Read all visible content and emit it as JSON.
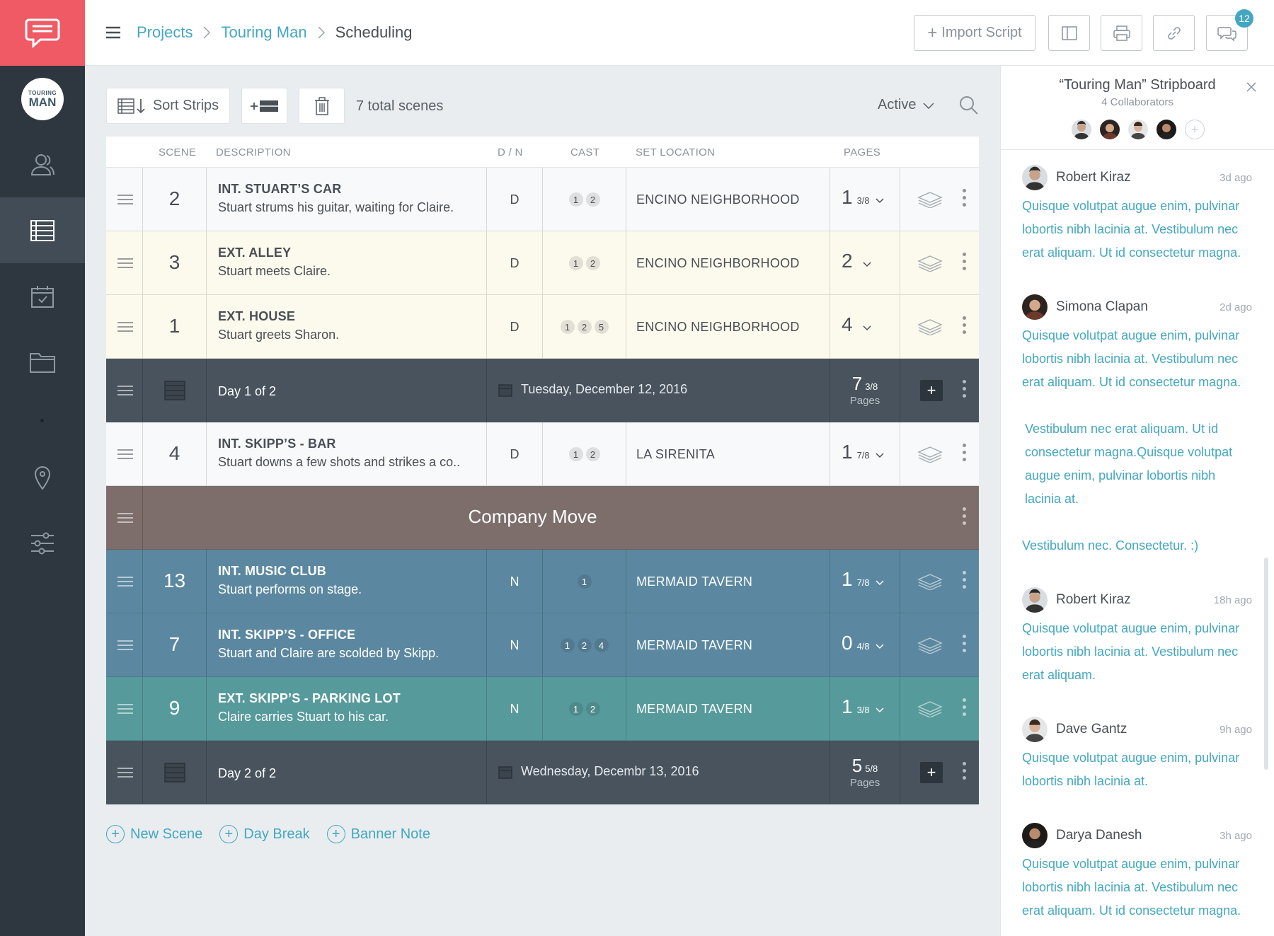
{
  "breadcrumb": {
    "projects": "Projects",
    "project": "Touring Man",
    "current": "Scheduling",
    "sep": ">"
  },
  "project_logo": {
    "line1": "TOURING",
    "line2": "MAN"
  },
  "topbar": {
    "import_label": "Import Script",
    "notifications_count": "12"
  },
  "toolbar": {
    "sort_label": "Sort Strips",
    "total_scenes": "7 total scenes",
    "filter_label": "Active"
  },
  "table": {
    "headers": {
      "scene": "SCENE",
      "description": "DESCRIPTION",
      "dn": "D / N",
      "cast": "CAST",
      "location": "SET LOCATION",
      "pages": "PAGES"
    },
    "rows": [
      {
        "scene": "2",
        "title": "INT. STUART’S CAR",
        "desc": "Stuart strums his guitar, waiting for Claire.",
        "dn": "D",
        "cast": [
          "1",
          "2"
        ],
        "location": "ENCINO NEIGHBORHOOD",
        "pages_whole": "1",
        "pages_frac": "3/8"
      },
      {
        "scene": "3",
        "title": "EXT. ALLEY",
        "desc": "Stuart meets Claire.",
        "dn": "D",
        "cast": [
          "1",
          "2"
        ],
        "location": "ENCINO NEIGHBORHOOD",
        "pages_whole": "2",
        "pages_frac": ""
      },
      {
        "scene": "1",
        "title": "EXT. HOUSE",
        "desc": "Stuart greets Sharon.",
        "dn": "D",
        "cast": [
          "1",
          "2",
          "5"
        ],
        "location": "ENCINO NEIGHBORHOOD",
        "pages_whole": "4",
        "pages_frac": ""
      },
      {
        "scene": "4",
        "title": "INT. SKIPP’S - BAR",
        "desc": "Stuart downs a few shots and strikes a co..",
        "dn": "D",
        "cast": [
          "1",
          "2"
        ],
        "location": "LA SIRENITA",
        "pages_whole": "1",
        "pages_frac": "7/8"
      },
      {
        "scene": "13",
        "title": "INT. MUSIC CLUB",
        "desc": "Stuart performs on stage.",
        "dn": "N",
        "cast": [
          "1"
        ],
        "location": "MERMAID TAVERN",
        "pages_whole": "1",
        "pages_frac": "7/8"
      },
      {
        "scene": "7",
        "title": "INT. SKIPP’S - OFFICE",
        "desc": "Stuart and Claire are scolded by Skipp.",
        "dn": "N",
        "cast": [
          "1",
          "2",
          "4"
        ],
        "location": "MERMAID TAVERN",
        "pages_whole": "0",
        "pages_frac": "4/8"
      },
      {
        "scene": "9",
        "title": "EXT. SKIPP’S - PARKING LOT",
        "desc": "Claire carries Stuart to his car.",
        "dn": "N",
        "cast": [
          "1",
          "2"
        ],
        "location": "MERMAID TAVERN",
        "pages_whole": "1",
        "pages_frac": "3/8"
      }
    ],
    "days": [
      {
        "label": "Day 1 of 2",
        "date": "Tuesday, December 12, 2016",
        "pages_whole": "7",
        "pages_frac": "3/8",
        "pages_word": "Pages"
      },
      {
        "label": "Day 2 of 2",
        "date": "Wednesday, Decembr 13, 2016",
        "pages_whole": "5",
        "pages_frac": "5/8",
        "pages_word": "Pages"
      }
    ],
    "banner": "Company Move"
  },
  "add_links": {
    "new_scene": "New Scene",
    "day_break": "Day Break",
    "banner_note": "Banner Note"
  },
  "panel": {
    "title": "“Touring Man” Stripboard",
    "subtitle": "4 Collaborators",
    "comments": [
      {
        "name": "Robert Kiraz",
        "time": "3d ago",
        "body": "Quisque volutpat augue enim, pulvinar lobortis nibh lacinia at. Vestibulum nec erat aliquam. Ut id consectetur magna."
      },
      {
        "name": "Simona Clapan",
        "time": "2d ago",
        "body": "Quisque volutpat augue enim, pulvinar lobortis nibh lacinia at. Vestibulum nec erat aliquam. Ut id consectetur magna.",
        "body2": "Vestibulum nec erat aliquam. Ut id consectetur magna.Quisque volutpat augue enim, pulvinar lobortis nibh lacinia at.",
        "body3": "Vestibulum nec. Consectetur.  :)"
      },
      {
        "name": "Robert Kiraz",
        "time": "18h ago",
        "body": "Quisque volutpat augue enim, pulvinar lobortis nibh lacinia at. Vestibulum nec erat aliquam."
      },
      {
        "name": "Dave Gantz",
        "time": "9h ago",
        "body": "Quisque volutpat augue enim, pulvinar lobortis nibh lacinia at."
      },
      {
        "name": "Darya Danesh",
        "time": "3h ago",
        "body": "Quisque volutpat augue enim, pulvinar lobortis nibh lacinia at. Vestibulum nec erat aliquam. Ut id consectetur magna."
      }
    ]
  },
  "colors": {
    "brand": "#f05a64",
    "accent": "#44a7c0",
    "rail": "#2e3740",
    "day_strip": "#48535e",
    "banner": "#7d6e6b",
    "night_blue": "#5b88a0",
    "night_teal": "#579a9c",
    "day_cream": "#fcfaed"
  }
}
